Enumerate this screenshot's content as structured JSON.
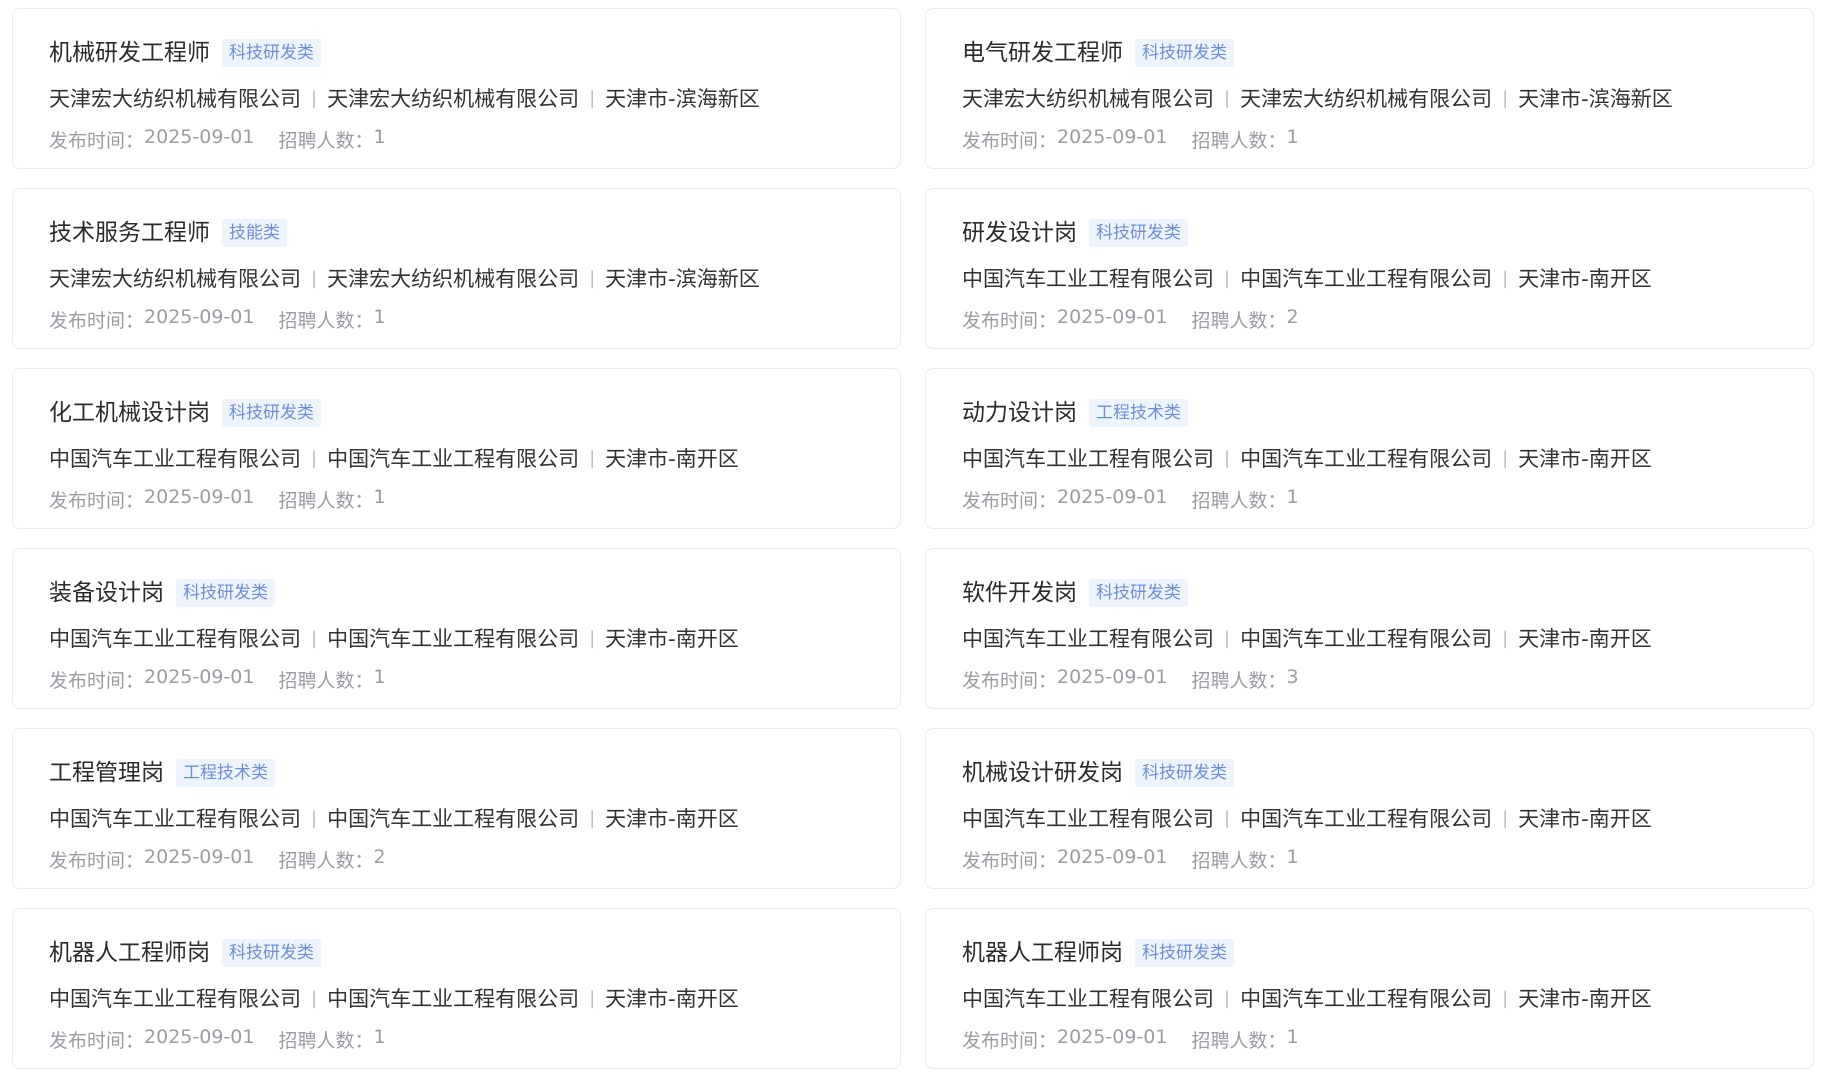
{
  "labels": {
    "publish_time": "发布时间：",
    "headcount": "招聘人数：",
    "separator": "|"
  },
  "jobs": [
    {
      "title": "机械研发工程师",
      "tag": "科技研发类",
      "company": "天津宏大纺织机械有限公司",
      "employer": "天津宏大纺织机械有限公司",
      "location": "天津市-滨海新区",
      "date": "2025-09-01",
      "count": "1"
    },
    {
      "title": "电气研发工程师",
      "tag": "科技研发类",
      "company": "天津宏大纺织机械有限公司",
      "employer": "天津宏大纺织机械有限公司",
      "location": "天津市-滨海新区",
      "date": "2025-09-01",
      "count": "1"
    },
    {
      "title": "技术服务工程师",
      "tag": "技能类",
      "company": "天津宏大纺织机械有限公司",
      "employer": "天津宏大纺织机械有限公司",
      "location": "天津市-滨海新区",
      "date": "2025-09-01",
      "count": "1"
    },
    {
      "title": "研发设计岗",
      "tag": "科技研发类",
      "company": "中国汽车工业工程有限公司",
      "employer": "中国汽车工业工程有限公司",
      "location": "天津市-南开区",
      "date": "2025-09-01",
      "count": "2"
    },
    {
      "title": "化工机械设计岗",
      "tag": "科技研发类",
      "company": "中国汽车工业工程有限公司",
      "employer": "中国汽车工业工程有限公司",
      "location": "天津市-南开区",
      "date": "2025-09-01",
      "count": "1"
    },
    {
      "title": "动力设计岗",
      "tag": "工程技术类",
      "company": "中国汽车工业工程有限公司",
      "employer": "中国汽车工业工程有限公司",
      "location": "天津市-南开区",
      "date": "2025-09-01",
      "count": "1"
    },
    {
      "title": "装备设计岗",
      "tag": "科技研发类",
      "company": "中国汽车工业工程有限公司",
      "employer": "中国汽车工业工程有限公司",
      "location": "天津市-南开区",
      "date": "2025-09-01",
      "count": "1"
    },
    {
      "title": "软件开发岗",
      "tag": "科技研发类",
      "company": "中国汽车工业工程有限公司",
      "employer": "中国汽车工业工程有限公司",
      "location": "天津市-南开区",
      "date": "2025-09-01",
      "count": "3"
    },
    {
      "title": "工程管理岗",
      "tag": "工程技术类",
      "company": "中国汽车工业工程有限公司",
      "employer": "中国汽车工业工程有限公司",
      "location": "天津市-南开区",
      "date": "2025-09-01",
      "count": "2"
    },
    {
      "title": "机械设计研发岗",
      "tag": "科技研发类",
      "company": "中国汽车工业工程有限公司",
      "employer": "中国汽车工业工程有限公司",
      "location": "天津市-南开区",
      "date": "2025-09-01",
      "count": "1"
    },
    {
      "title": "机器人工程师岗",
      "tag": "科技研发类",
      "company": "中国汽车工业工程有限公司",
      "employer": "中国汽车工业工程有限公司",
      "location": "天津市-南开区",
      "date": "2025-09-01",
      "count": "1"
    },
    {
      "title": "机器人工程师岗",
      "tag": "科技研发类",
      "company": "中国汽车工业工程有限公司",
      "employer": "中国汽车工业工程有限公司",
      "location": "天津市-南开区",
      "date": "2025-09-01",
      "count": "1"
    }
  ]
}
